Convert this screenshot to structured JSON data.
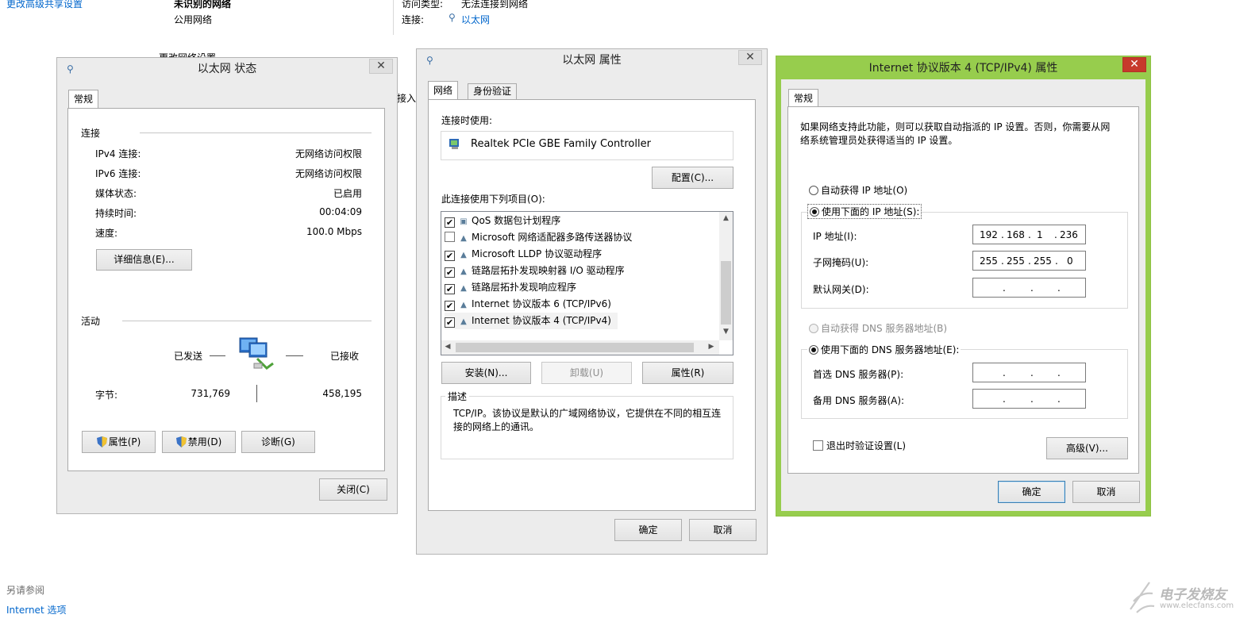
{
  "background": {
    "sidebar_link": "更改高级共享设置",
    "network_name": "未识别的网络",
    "network_type": "公用网络",
    "change_settings_fragment": "更改网络设置",
    "access_type_label": "访问类型:",
    "access_type_value": "无法连接到网络",
    "connection_label": "连接:",
    "connection_value": "以太网",
    "cutoff_text": "接入",
    "see_also_label": "另请参阅",
    "internet_options_link": "Internet 选项",
    "watermark_brand": "电子发烧友",
    "watermark_url": "www.elecfans.com"
  },
  "status_window": {
    "title": "以太网 状态",
    "close_glyph": "✕",
    "tab": "常规",
    "connection_group": "连接",
    "rows": [
      {
        "label": "IPv4 连接:",
        "value": "无网络访问权限"
      },
      {
        "label": "IPv6 连接:",
        "value": "无网络访问权限"
      },
      {
        "label": "媒体状态:",
        "value": "已启用"
      },
      {
        "label": "持续时间:",
        "value": "00:04:09"
      },
      {
        "label": "速度:",
        "value": "100.0 Mbps"
      }
    ],
    "details_button": "详细信息(E)...",
    "activity_group": "活动",
    "sent_label": "已发送",
    "received_label": "已接收",
    "bytes_label": "字节:",
    "bytes_sent": "731,769",
    "bytes_received": "458,195",
    "properties_button": "属性(P)",
    "disable_button": "禁用(D)",
    "diagnose_button": "诊断(G)",
    "close_button": "关闭(C)"
  },
  "props_window": {
    "title": "以太网 属性",
    "close_glyph": "✕",
    "tab_network": "网络",
    "tab_auth": "身份验证",
    "connect_using_label": "连接时使用:",
    "adapter_name": "Realtek PCIe GBE Family Controller",
    "configure_button": "配置(C)...",
    "items_label": "此连接使用下列项目(O):",
    "items": [
      {
        "label": "QoS 数据包计划程序",
        "checked": true
      },
      {
        "label": "Microsoft 网络适配器多路传送器协议",
        "checked": false
      },
      {
        "label": "Microsoft LLDP 协议驱动程序",
        "checked": true
      },
      {
        "label": "链路层拓扑发现映射器 I/O 驱动程序",
        "checked": true
      },
      {
        "label": "链路层拓扑发现响应程序",
        "checked": true
      },
      {
        "label": "Internet 协议版本 6 (TCP/IPv6)",
        "checked": true
      },
      {
        "label": "Internet 协议版本 4 (TCP/IPv4)",
        "checked": true
      }
    ],
    "install_button": "安装(N)...",
    "uninstall_button": "卸载(U)",
    "properties_button": "属性(R)",
    "description_group": "描述",
    "description_text": "TCP/IP。该协议是默认的广域网络协议，它提供在不同的相互连接的网络上的通讯。",
    "ok_button": "确定",
    "cancel_button": "取消"
  },
  "ipv4_window": {
    "title": "Internet 协议版本 4 (TCP/IPv4) 属性",
    "close_glyph": "✕",
    "tab": "常规",
    "intro_text": "如果网络支持此功能，则可以获取自动指派的 IP 设置。否则，你需要从网络系统管理员处获得适当的 IP 设置。",
    "auto_ip_radio": "自动获得 IP 地址(O)",
    "manual_ip_radio": "使用下面的 IP 地址(S):",
    "ip_label": "IP 地址(I):",
    "ip_octets": [
      "192",
      "168",
      "1",
      "236"
    ],
    "mask_label": "子网掩码(U):",
    "mask_octets": [
      "255",
      "255",
      "255",
      "0"
    ],
    "gateway_label": "默认网关(D):",
    "auto_dns_radio": "自动获得 DNS 服务器地址(B)",
    "manual_dns_radio": "使用下面的 DNS 服务器地址(E):",
    "preferred_dns_label": "首选 DNS 服务器(P):",
    "alternate_dns_label": "备用 DNS 服务器(A):",
    "validate_checkbox": "退出时验证设置(L)",
    "advanced_button": "高级(V)...",
    "ok_button": "确定",
    "cancel_button": "取消",
    "dot": "."
  },
  "colors": {
    "active_frame": "#97cd4d",
    "link": "#0066cc",
    "close_active": "#c7392b"
  }
}
